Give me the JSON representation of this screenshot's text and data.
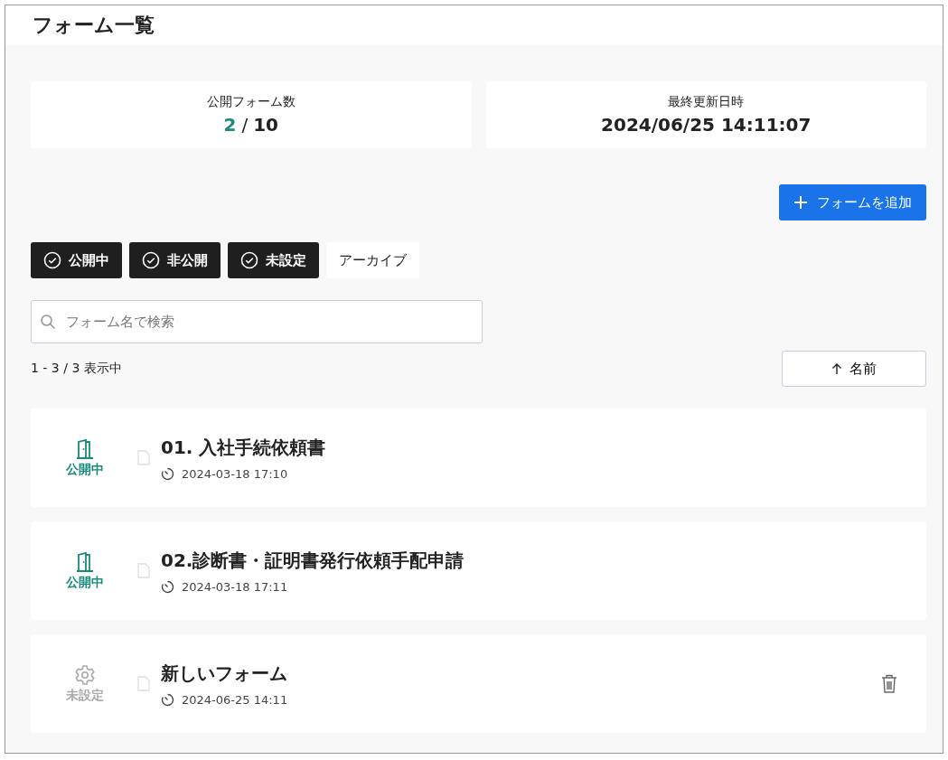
{
  "title": "フォーム一覧",
  "stats": [
    {
      "label": "公開フォーム数",
      "kind": "ratio",
      "value": "2",
      "separator": "/",
      "total": "10"
    },
    {
      "label": "最終更新日時",
      "kind": "plain",
      "value": "2024/06/25 14:11:07"
    }
  ],
  "add_button": "フォームを追加",
  "filters": [
    {
      "label": "公開中",
      "selected": true
    },
    {
      "label": "非公開",
      "selected": true
    },
    {
      "label": "未設定",
      "selected": true
    },
    {
      "label": "アーカイブ",
      "selected": false
    }
  ],
  "search": {
    "placeholder": "フォーム名で検索"
  },
  "count": "1 - 3 / 3 表示中",
  "sort_button": "名前",
  "forms": [
    {
      "status": "公開中",
      "kind": "published",
      "title": "01. 入社手続依頼書",
      "updated": "2024-03-18 17:10",
      "deletable": false
    },
    {
      "status": "公開中",
      "kind": "published",
      "title": "02.診断書・証明書発行依頼手配申請",
      "updated": "2024-03-18 17:11",
      "deletable": false
    },
    {
      "status": "未設定",
      "kind": "unset",
      "title": "新しいフォーム",
      "updated": "2024-06-25 14:11",
      "deletable": true
    }
  ]
}
